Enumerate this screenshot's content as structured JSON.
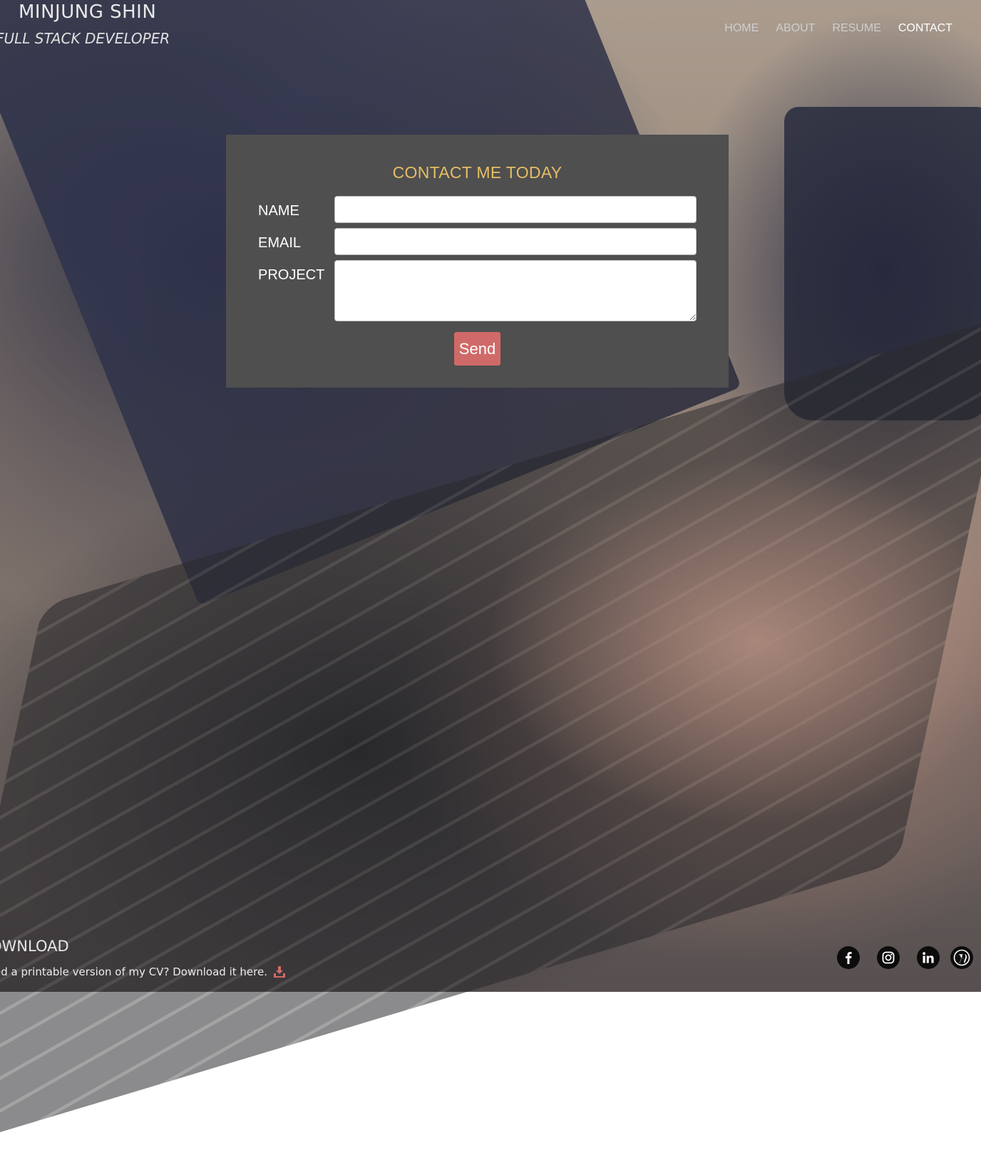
{
  "header": {
    "name": "MINJUNG SHIN",
    "tagline": "FULL STACK DEVELOPER"
  },
  "nav": {
    "items": [
      {
        "label": "HOME",
        "active": false
      },
      {
        "label": "ABOUT",
        "active": false
      },
      {
        "label": "RESUME",
        "active": false
      },
      {
        "label": "CONTACT",
        "active": true
      }
    ]
  },
  "contact_form": {
    "title": "CONTACT ME TODAY",
    "name_label": "NAME",
    "name_value": "",
    "email_label": "EMAIL",
    "email_value": "",
    "project_label": "PROJECT",
    "project_value": "",
    "send_label": "Send"
  },
  "footer": {
    "download_title": "OWNLOAD",
    "download_text": "ed a printable version of my CV? Download it here.",
    "download_icon": "download-icon",
    "socials": [
      "facebook-icon",
      "instagram-icon",
      "linkedin-icon",
      "wordpress-icon"
    ]
  },
  "colors": {
    "panel_bg": "#4f4f4f",
    "title_accent": "#e6be63",
    "send_button": "#d06a68",
    "download_icon": "#d06a68",
    "social_bg": "#0c0c0c"
  }
}
